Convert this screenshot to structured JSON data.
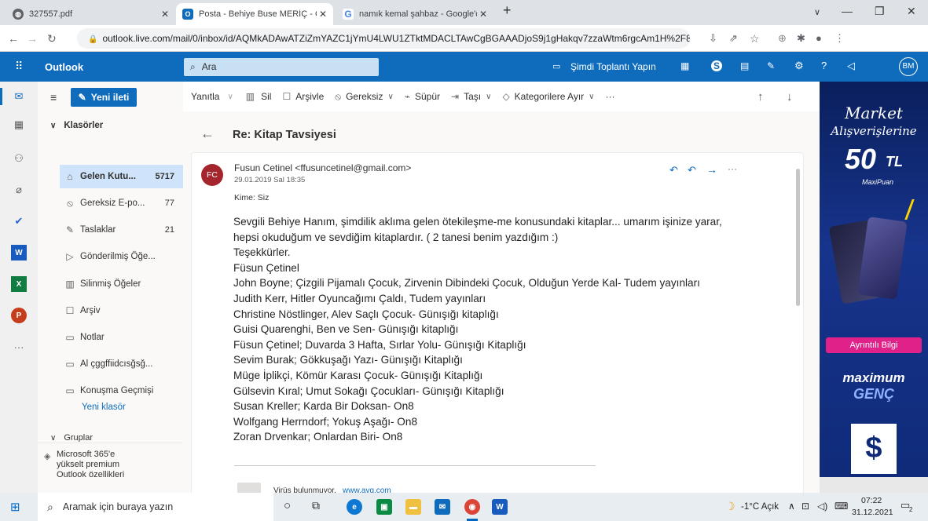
{
  "browser": {
    "tabs": [
      {
        "title": "327557.pdf"
      },
      {
        "title": "Posta - Behiye Buse MERİÇ - Outl"
      },
      {
        "title": "namık kemal şahbaz - Google'da"
      }
    ],
    "url": "outlook.live.com/mail/0/inbox/id/AQMkADAwATZiZmYAZC1jYmU4LWU1ZTktMDACLTAwCgBGAAADjoS9j1gHakqv7zzaWtm6rgcAm1H%2F8QK3qU6XOaVQzX..."
  },
  "outlook": {
    "app_name": "Outlook",
    "search_placeholder": "Ara",
    "meet_now": "Şimdi Toplantı Yapın",
    "avatar": "BM",
    "new_mail": "Yeni ileti"
  },
  "folders": {
    "header": "Klasörler",
    "items": [
      {
        "label": "Gelen Kutu...",
        "count": "5717",
        "icon": "inbox-icon"
      },
      {
        "label": "Gereksiz E-po...",
        "count": "77",
        "icon": "junk-icon"
      },
      {
        "label": "Taslaklar",
        "count": "21",
        "icon": "draft-icon"
      },
      {
        "label": "Gönderilmiş Öğe...",
        "count": "",
        "icon": "sent-icon"
      },
      {
        "label": "Silinmiş Öğeler",
        "count": "",
        "icon": "trash-icon"
      },
      {
        "label": "Arşiv",
        "count": "",
        "icon": "archive-icon"
      },
      {
        "label": "Notlar",
        "count": "",
        "icon": "note-icon"
      },
      {
        "label": "Al çggffiidcısğsğ...",
        "count": "",
        "icon": "folder-icon"
      },
      {
        "label": "Konuşma Geçmişi",
        "count": "",
        "icon": "folder-icon"
      }
    ],
    "new_folder": "Yeni klasör",
    "groups": "Gruplar",
    "upsell": "Microsoft 365'e yükselt premium Outlook özellikleri"
  },
  "toolbar": {
    "reply": "Yanıtla",
    "delete": "Sil",
    "archive": "Arşivle",
    "junk": "Gereksiz",
    "sweep": "Süpür",
    "move": "Taşı",
    "categorize": "Kategorilere Ayır"
  },
  "message": {
    "subject": "Re: Kitap Tavsiyesi",
    "initials": "FC",
    "from": "Fusun Cetinel <ffusuncetinel@gmail.com>",
    "date": "29.01.2019 Sal 18:35",
    "to": "Kime: Siz",
    "body": [
      "Sevgili Behiye Hanım, şimdilik aklıma gelen ötekileşme-me konusundaki kitaplar... umarım işinize yarar,",
      "hepsi okuduğum ve sevdiğim kitaplardır. ( 2 tanesi benim yazdığım :)",
      "Teşekkürler.",
      "Füsun Çetinel",
      "John Boyne; Çizgili Pijamalı Çocuk, Zirvenin Dibindeki Çocuk, Olduğun Yerde Kal- Tudem yayınları",
      "Judith Kerr, Hitler Oyuncağımı Çaldı, Tudem yayınları",
      "Christine Nöstlinger, Alev Saçlı Çocuk- Günışığı kitaplığı",
      "Guisi Quarenghi, Ben ve Sen- Günışığı kitaplığı",
      "Füsun Çetinel; Duvarda 3 Hafta, Sırlar Yolu- Günışığı Kitaplığı",
      "Sevim Burak; Gökkuşağı Yazı- Günışığı Kitaplığı",
      "Müge İplikçi, Kömür Karası Çocuk- Günışığı Kitaplığı",
      "Gülsevin Kıral; Umut Sokağı Çocukları- Günışığı Kitaplığı",
      "Susan Kreller; Karda Bir Doksan- On8",
      "Wolfgang Herrndorf; Yokuş Aşağı- On8",
      "Zoran Drvenkar; Onlardan Biri- On8"
    ],
    "footer": "Virüs bulunmuyor.",
    "footer_link": "www.avg.com"
  },
  "ad": {
    "line1": "Market",
    "line2": "Alışverişlerine",
    "amount": "50",
    "currency": "TL",
    "sub": "MaxiPuan",
    "button": "Ayrıntılı Bilgi",
    "brand1": "maximum",
    "brand2": "GENÇ"
  },
  "taskbar": {
    "search": "Aramak için buraya yazın",
    "weather": "-1°C Açık",
    "time": "07:22",
    "date": "31.12.2021",
    "notif": "2"
  }
}
